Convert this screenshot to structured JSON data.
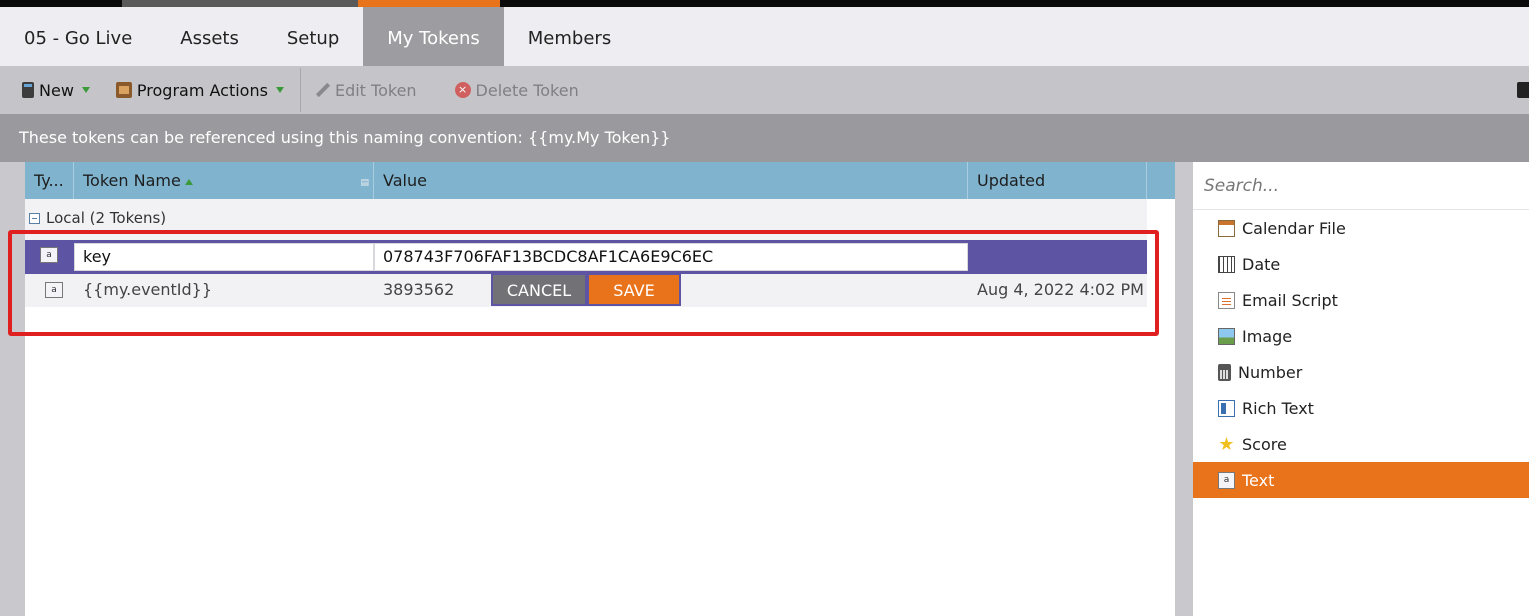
{
  "tabs": [
    {
      "label": "05 - Go Live",
      "active": false
    },
    {
      "label": "Assets",
      "active": false
    },
    {
      "label": "Setup",
      "active": false
    },
    {
      "label": "My Tokens",
      "active": true
    },
    {
      "label": "Members",
      "active": false
    }
  ],
  "toolbar": {
    "new_label": "New",
    "program_actions_label": "Program Actions",
    "edit_token_label": "Edit Token",
    "delete_token_label": "Delete Token"
  },
  "info": {
    "text": "These tokens can be referenced using this naming convention: {{my.My Token}}"
  },
  "grid": {
    "columns": {
      "type": "Ty...",
      "name": "Token Name",
      "value": "Value",
      "updated": "Updated"
    },
    "group_label": "Local (2 Tokens)",
    "edit_row": {
      "type_icon": "a",
      "name_value": "key",
      "value_value": "078743F706FAF13BCDC8AF1CA6E9C6EC"
    },
    "rows": [
      {
        "type_icon": "a",
        "name": "{{my.eventId}}",
        "value": "3893562",
        "updated": "Aug 4, 2022 4:02 PM"
      }
    ],
    "cancel_label": "CANCEL",
    "save_label": "SAVE"
  },
  "right_panel": {
    "search_placeholder": "Search...",
    "types": [
      {
        "label": "Calendar File",
        "icon": "calendar-icon",
        "selected": false
      },
      {
        "label": "Date",
        "icon": "date-icon",
        "selected": false
      },
      {
        "label": "Email Script",
        "icon": "email-script-icon",
        "selected": false
      },
      {
        "label": "Image",
        "icon": "image-icon",
        "selected": false
      },
      {
        "label": "Number",
        "icon": "number-icon",
        "selected": false
      },
      {
        "label": "Rich Text",
        "icon": "rich-text-icon",
        "selected": false
      },
      {
        "label": "Score",
        "icon": "star-icon",
        "selected": false
      },
      {
        "label": "Text",
        "icon": "text-icon",
        "selected": true
      }
    ]
  },
  "colors": {
    "accent_orange": "#e8731a",
    "edit_row_purple": "#5d55a3",
    "grid_header_blue": "#7fb3ce",
    "highlight_red": "#e02020"
  }
}
